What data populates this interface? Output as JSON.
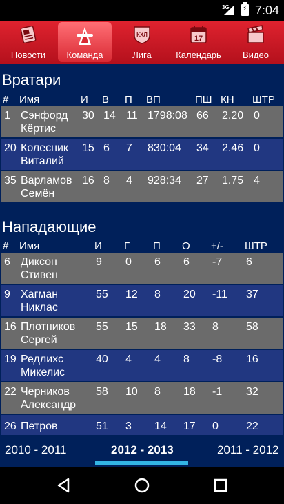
{
  "status": {
    "network": "3G",
    "time": "7:04"
  },
  "tabs": [
    {
      "label": "Новости",
      "icon": "newspaper-icon"
    },
    {
      "label": "Команда",
      "icon": "team-logo-icon"
    },
    {
      "label": "Лига",
      "icon": "khl-shield-icon"
    },
    {
      "label": "Календарь",
      "icon": "calendar-icon"
    },
    {
      "label": "Видео",
      "icon": "clapperboard-icon"
    }
  ],
  "goalies": {
    "title": "Вратари",
    "headers": [
      "#",
      "Имя",
      "И",
      "В",
      "П",
      "ВП",
      "ПШ",
      "КН",
      "ШТР"
    ],
    "rows": [
      {
        "num": "1",
        "name1": "Сэнфорд",
        "name2": "Кёртис",
        "games": "30",
        "wins": "14",
        "losses": "11",
        "toi": "1798:08",
        "ga": "66",
        "gaa": "2.20",
        "pim": "0"
      },
      {
        "num": "20",
        "name1": "Колесник",
        "name2": "Виталий",
        "games": "15",
        "wins": "6",
        "losses": "7",
        "toi": "830:04",
        "ga": "34",
        "gaa": "2.46",
        "pim": "0"
      },
      {
        "num": "35",
        "name1": "Варламов",
        "name2": "Семён",
        "games": "16",
        "wins": "8",
        "losses": "4",
        "toi": "928:34",
        "ga": "27",
        "gaa": "1.75",
        "pim": "4"
      }
    ]
  },
  "forwards": {
    "title": "Нападающие",
    "headers": [
      "#",
      "Имя",
      "И",
      "Г",
      "П",
      "О",
      "+/-",
      "ШТР"
    ],
    "rows": [
      {
        "num": "6",
        "name1": "Диксон",
        "name2": "Стивен",
        "games": "9",
        "goals": "0",
        "assists": "6",
        "points": "6",
        "pm": "-7",
        "pim": "6"
      },
      {
        "num": "9",
        "name1": "Хагман",
        "name2": "Никлас",
        "games": "55",
        "goals": "12",
        "assists": "8",
        "points": "20",
        "pm": "-11",
        "pim": "37"
      },
      {
        "num": "16",
        "name1": "Плотников",
        "name2": "Сергей",
        "games": "55",
        "goals": "15",
        "assists": "18",
        "points": "33",
        "pm": "8",
        "pim": "58"
      },
      {
        "num": "19",
        "name1": "Редлихс",
        "name2": "Микелис",
        "games": "40",
        "goals": "4",
        "assists": "4",
        "points": "8",
        "pm": "-8",
        "pim": "16"
      },
      {
        "num": "22",
        "name1": "Черников",
        "name2": "Александр",
        "games": "58",
        "goals": "10",
        "assists": "8",
        "points": "18",
        "pm": "-1",
        "pim": "32"
      },
      {
        "num": "26",
        "name1": "Петров",
        "name2": "",
        "games": "51",
        "goals": "3",
        "assists": "14",
        "points": "17",
        "pm": "0",
        "pim": "22"
      }
    ]
  },
  "seasons": {
    "left": "2010 - 2011",
    "active": "2012 - 2013",
    "right": "2011 - 2012"
  },
  "navbar": {
    "back": "back-icon",
    "home": "home-icon",
    "recents": "recents-icon"
  }
}
